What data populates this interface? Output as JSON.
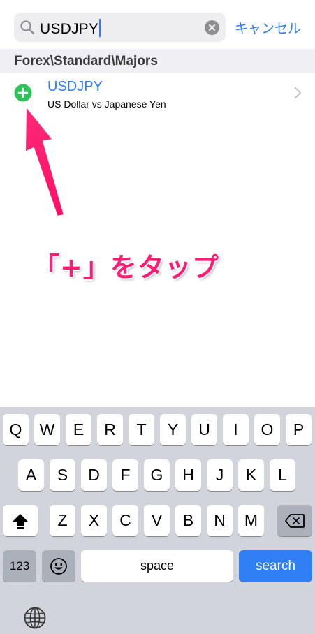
{
  "search": {
    "query": "USDJPY",
    "cancel_label": "キャンセル"
  },
  "section": {
    "title": "Forex\\Standard\\Majors"
  },
  "result": {
    "symbol": "USDJPY",
    "description": "US Dollar vs Japanese Yen"
  },
  "annotation": {
    "text": "「+」をタップ"
  },
  "colors": {
    "accent": "#2f7ff5",
    "add_green": "#30c25a",
    "annotation_pink": "#ff1c72"
  },
  "keyboard": {
    "row1": [
      "Q",
      "W",
      "E",
      "R",
      "T",
      "Y",
      "U",
      "I",
      "O",
      "P"
    ],
    "row2": [
      "A",
      "S",
      "D",
      "F",
      "G",
      "H",
      "J",
      "K",
      "L"
    ],
    "row3": [
      "Z",
      "X",
      "C",
      "V",
      "B",
      "N",
      "M"
    ],
    "numbers_label": "123",
    "space_label": "space",
    "search_label": "search"
  }
}
